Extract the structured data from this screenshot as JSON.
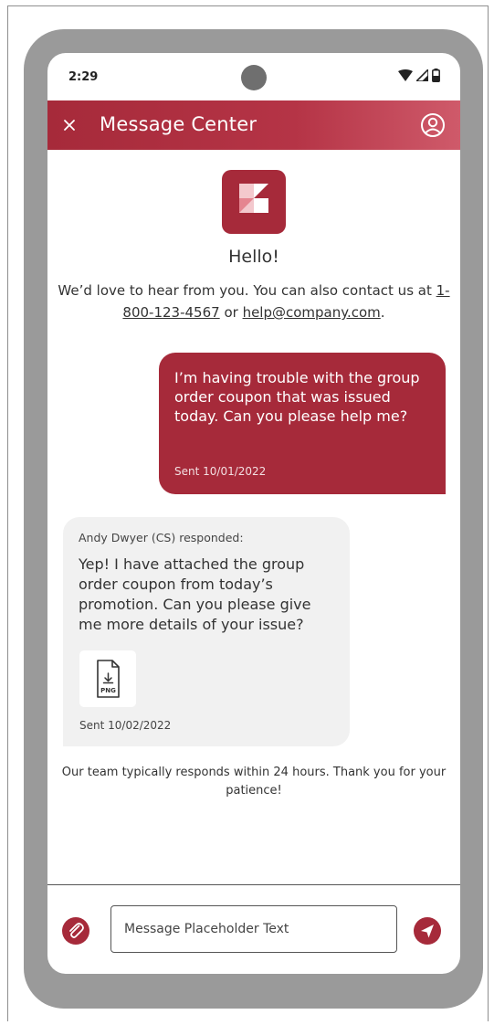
{
  "status_bar": {
    "time": "2:29",
    "icons": [
      "wifi-icon",
      "signal-icon",
      "battery-icon"
    ]
  },
  "header": {
    "title": "Message Center",
    "close_icon": "close-icon",
    "profile_icon": "profile-icon"
  },
  "welcome": {
    "greeting": "Hello!",
    "intro_before": "We’d love to hear from you. You can also contact us at ",
    "phone": "1-800-123-4567",
    "intro_middle": " or ",
    "email": "help@company.com",
    "intro_after": "."
  },
  "messages": [
    {
      "direction": "outgoing",
      "text": "I’m having trouble with the group order coupon that was issued today. Can you please help me?",
      "sent": "Sent 10/01/2022"
    },
    {
      "direction": "incoming",
      "author": "Andy Dwyer (CS) responded:",
      "text": "Yep! I have attached the group order coupon from today’s promotion. Can you please give me more details of your issue?",
      "attachment_type": "PNG",
      "sent": "Sent 10/02/2022"
    }
  ],
  "footer_note": "Our team typically responds within 24 hours. Thank you for your patience!",
  "composer": {
    "placeholder": "Message Placeholder Text",
    "value": "",
    "attach_icon": "paperclip-icon",
    "send_icon": "send-icon"
  },
  "colors": {
    "brand": "#a62a3a",
    "header_gradient_end": "#cf5a6a",
    "incoming_bubble": "#f1f1f1",
    "phone_frame": "#9a9a9a"
  }
}
